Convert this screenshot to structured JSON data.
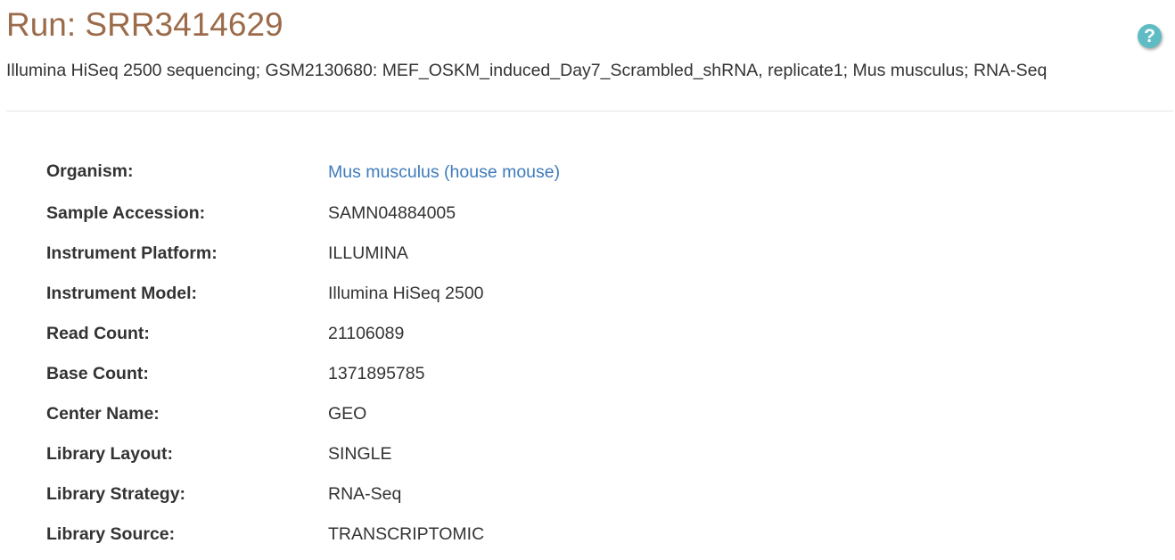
{
  "header": {
    "title": "Run: SRR3414629",
    "description": "Illumina HiSeq 2500 sequencing; GSM2130680: MEF_OSKM_induced_Day7_Scrambled_shRNA, replicate1; Mus musculus; RNA-Seq",
    "help_glyph": "?",
    "help_icon": "question-circle-icon"
  },
  "details": {
    "organism": {
      "label": "Organism:",
      "value": "Mus musculus (house mouse)"
    },
    "sample_accession": {
      "label": "Sample Accession:",
      "value": "SAMN04884005"
    },
    "instrument_platform": {
      "label": "Instrument Platform:",
      "value": "ILLUMINA"
    },
    "instrument_model": {
      "label": "Instrument Model:",
      "value": "Illumina HiSeq 2500"
    },
    "read_count": {
      "label": "Read Count:",
      "value": "21106089"
    },
    "base_count": {
      "label": "Base Count:",
      "value": "1371895785"
    },
    "center_name": {
      "label": "Center Name:",
      "value": "GEO"
    },
    "library_layout": {
      "label": "Library Layout:",
      "value": "SINGLE"
    },
    "library_strategy": {
      "label": "Library Strategy:",
      "value": "RNA-Seq"
    },
    "library_source": {
      "label": "Library Source:",
      "value": "TRANSCRIPTOMIC"
    }
  },
  "colors": {
    "title": "#9b6b4a",
    "link": "#3f7bbc",
    "help_button": "#5fbcc4",
    "text": "#333333"
  }
}
